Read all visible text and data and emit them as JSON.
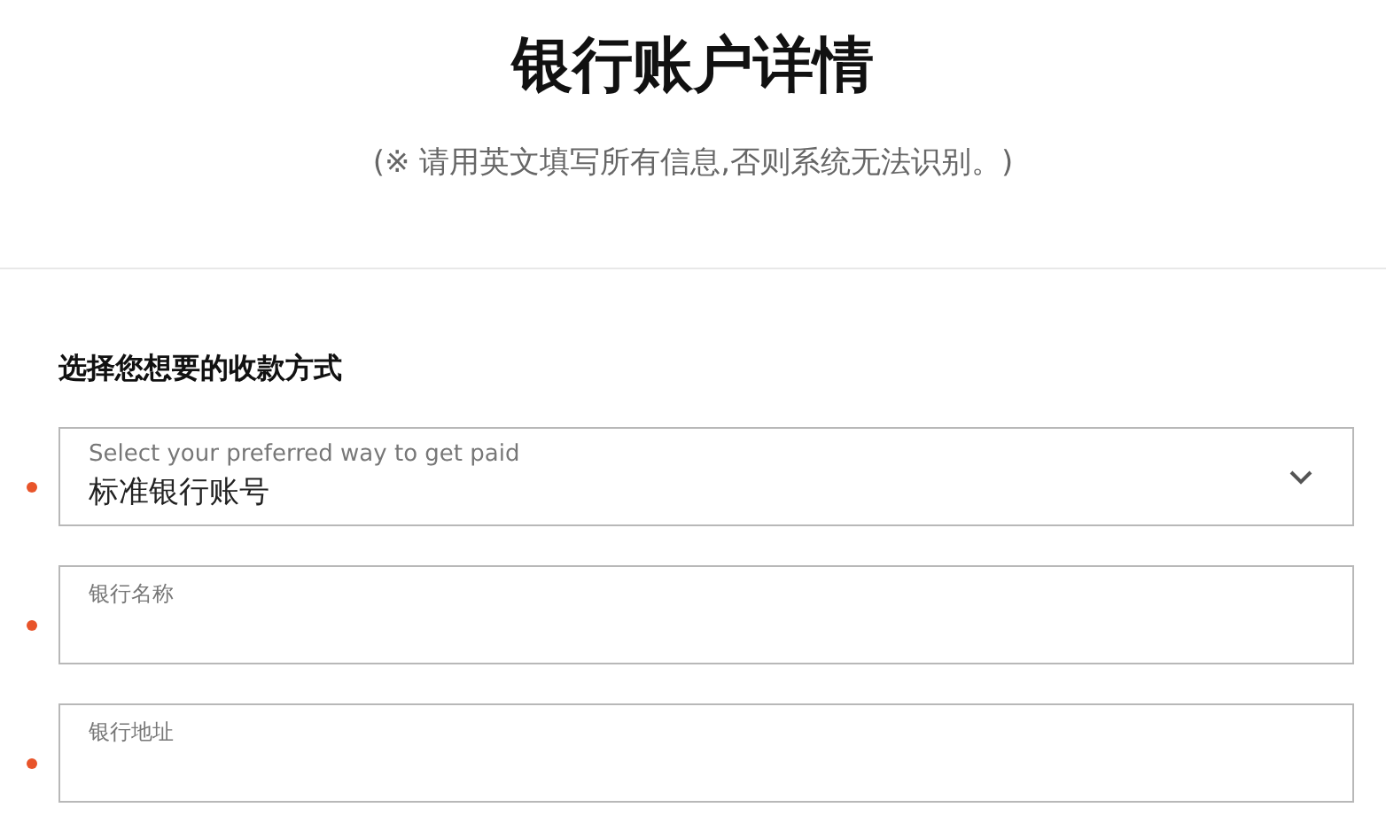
{
  "header": {
    "title": "银行账户详情",
    "subtitle": "(※ 请用英文填写所有信息,否则系统无法识别。)"
  },
  "section": {
    "heading": "选择您想要的收款方式"
  },
  "fields": [
    {
      "kind": "select",
      "label": "Select your preferred way to get paid",
      "value": "标准银行账号",
      "required": true
    },
    {
      "kind": "text",
      "label": "银行名称",
      "required": true
    },
    {
      "kind": "text",
      "label": "银行地址",
      "required": true
    }
  ]
}
